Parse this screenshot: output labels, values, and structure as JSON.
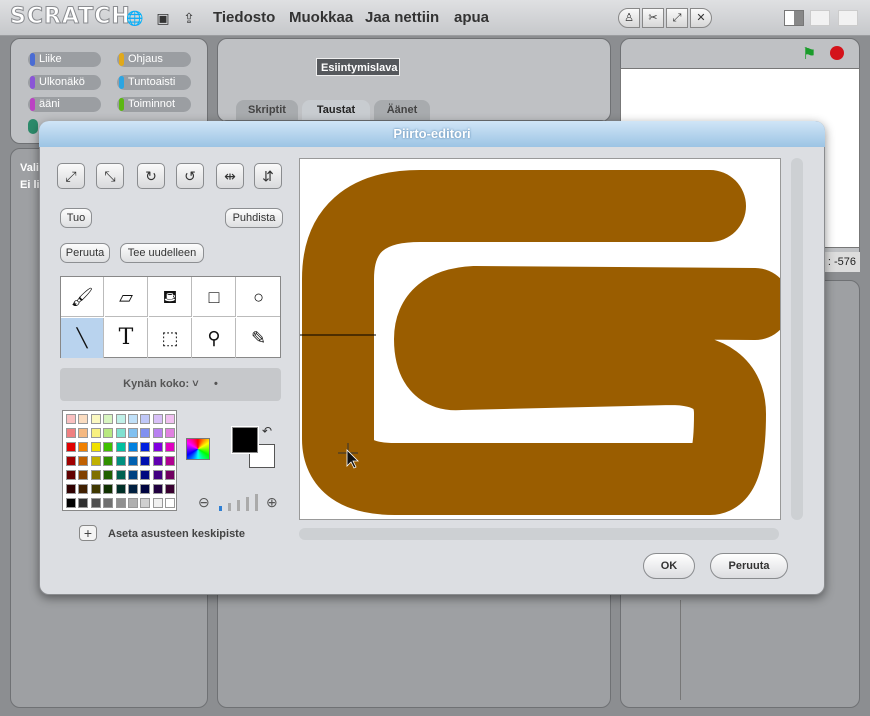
{
  "app": {
    "logo": "SCRATCH",
    "menu": [
      "Tiedosto",
      "Muokkaa",
      "Jaa nettiin",
      "apua"
    ],
    "icons": [
      "globe-icon",
      "save-icon",
      "share-icon"
    ],
    "toolbar_icons": [
      "stamp-icon",
      "scissors-icon",
      "grow-icon",
      "shrink-icon"
    ],
    "view_modes": [
      "small-stage-icon",
      "normal-stage-icon",
      "presentation-icon"
    ]
  },
  "categories": [
    {
      "label": "Liike",
      "color": "#4a6cd4"
    },
    {
      "label": "Ohjaus",
      "color": "#e1a91a"
    },
    {
      "label": "Ulkonäkö",
      "color": "#8a55d7"
    },
    {
      "label": "Tuntoaisti",
      "color": "#2ca5e2"
    },
    {
      "label": "ääni",
      "color": "#bb42c3"
    },
    {
      "label": "Toiminnot",
      "color": "#5cb712"
    }
  ],
  "sprite_label": "Esiintymislava",
  "tabs": [
    "Skriptit",
    "Taustat",
    "Äänet"
  ],
  "left_panel_text": [
    "Vali",
    "Ei li"
  ],
  "coordinate_readout": ": -576",
  "dialog": {
    "title": "Piirto-editori",
    "transform_icons": [
      "grow-icon",
      "shrink-icon",
      "rotate-right-icon",
      "rotate-left-icon",
      "flip-horizontal-icon",
      "flip-vertical-icon"
    ],
    "import_label": "Tuo",
    "clear_label": "Puhdista",
    "undo_label": "Peruuta",
    "redo_label": "Tee uudelleen",
    "tools": [
      {
        "name": "paintbrush-tool",
        "glyph": "🖌"
      },
      {
        "name": "eraser-tool",
        "glyph": "▱"
      },
      {
        "name": "fill-tool",
        "glyph": "⛾"
      },
      {
        "name": "rectangle-tool",
        "glyph": "□"
      },
      {
        "name": "ellipse-tool",
        "glyph": "○"
      },
      {
        "name": "line-tool",
        "glyph": "╲"
      },
      {
        "name": "text-tool",
        "glyph": "T"
      },
      {
        "name": "select-tool",
        "glyph": "⬚"
      },
      {
        "name": "stamp-tool",
        "glyph": "⚲"
      },
      {
        "name": "eyedropper-tool",
        "glyph": "✎"
      }
    ],
    "active_tool": "line-tool",
    "brush_size_label": "Kynän koko:",
    "foreground_color": "#000000",
    "background_color": "#ffffff",
    "set_center_label": "Aseta asusteen keskipiste",
    "ok_label": "OK",
    "cancel_label": "Peruuta",
    "drawing_color": "#9a5d00"
  },
  "palette": [
    [
      "#f9c0c0",
      "#fadcc0",
      "#fbf8c0",
      "#d8f5c0",
      "#c0f0e8",
      "#c0e0f8",
      "#c0c8f8",
      "#d8c0f8",
      "#f0c0f0"
    ],
    [
      "#f08080",
      "#f5b880",
      "#f8f080",
      "#b8e880",
      "#80e0d0",
      "#80c0f0",
      "#8090f0",
      "#b880f0",
      "#e080e0"
    ],
    [
      "#e00000",
      "#f08000",
      "#f0e000",
      "#40c000",
      "#00c0a0",
      "#0080e0",
      "#0020e0",
      "#8000e0",
      "#e000c0"
    ],
    [
      "#a00000",
      "#c06000",
      "#c0b000",
      "#309000",
      "#009080",
      "#0060b0",
      "#0010b0",
      "#6000b0",
      "#b00090"
    ],
    [
      "#600000",
      "#804000",
      "#807000",
      "#206000",
      "#006050",
      "#004080",
      "#000880",
      "#400080",
      "#700060"
    ],
    [
      "#300000",
      "#402000",
      "#403800",
      "#103000",
      "#003028",
      "#002040",
      "#000440",
      "#200040",
      "#380030"
    ],
    [
      "#000000",
      "#303030",
      "#505050",
      "#707070",
      "#909090",
      "#b0b0b0",
      "#d0d0d0",
      "#f0f0f0",
      "#ffffff"
    ]
  ]
}
